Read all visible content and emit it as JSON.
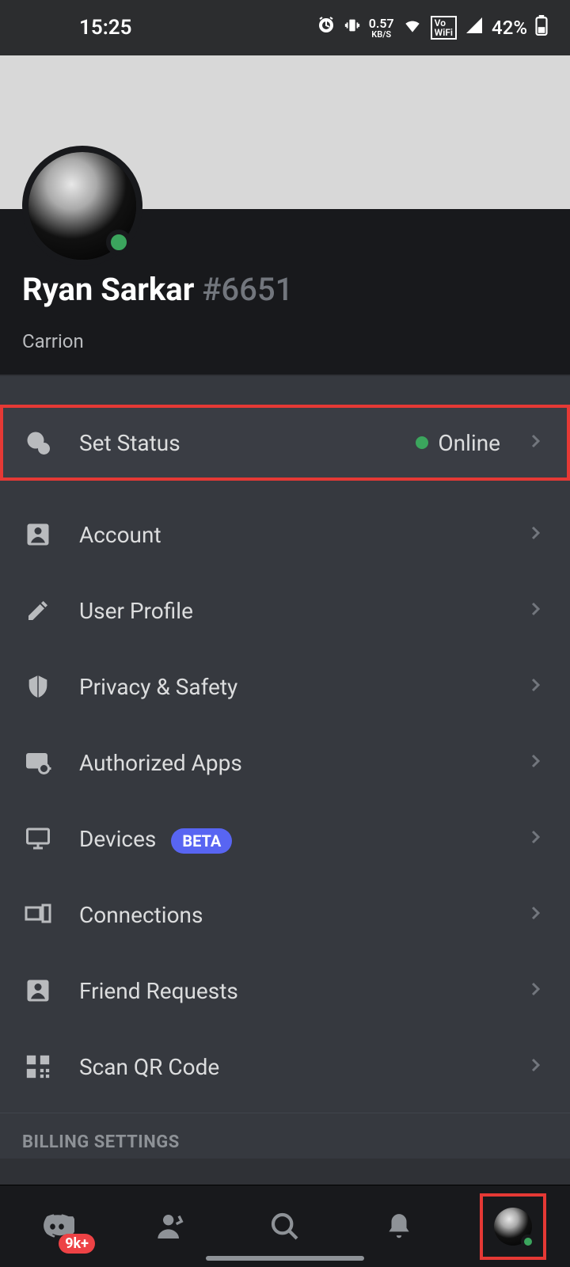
{
  "status_bar": {
    "time": "15:25",
    "net_speed": "0.57",
    "net_unit": "KB/S",
    "vowifi": "VoWiFi",
    "battery_pct": "42%"
  },
  "profile": {
    "display_name": "Ryan Sarkar",
    "discriminator": "#6651",
    "activity": "Carrion",
    "status": "Online"
  },
  "settings": {
    "set_status": {
      "label": "Set Status",
      "value": "Online"
    },
    "items": [
      {
        "label": "Account"
      },
      {
        "label": "User Profile"
      },
      {
        "label": "Privacy & Safety"
      },
      {
        "label": "Authorized Apps"
      },
      {
        "label": "Devices",
        "badge": "BETA"
      },
      {
        "label": "Connections"
      },
      {
        "label": "Friend Requests"
      },
      {
        "label": "Scan QR Code"
      }
    ]
  },
  "section_billing": "BILLING SETTINGS",
  "bottom_nav": {
    "badge": "9k+"
  }
}
